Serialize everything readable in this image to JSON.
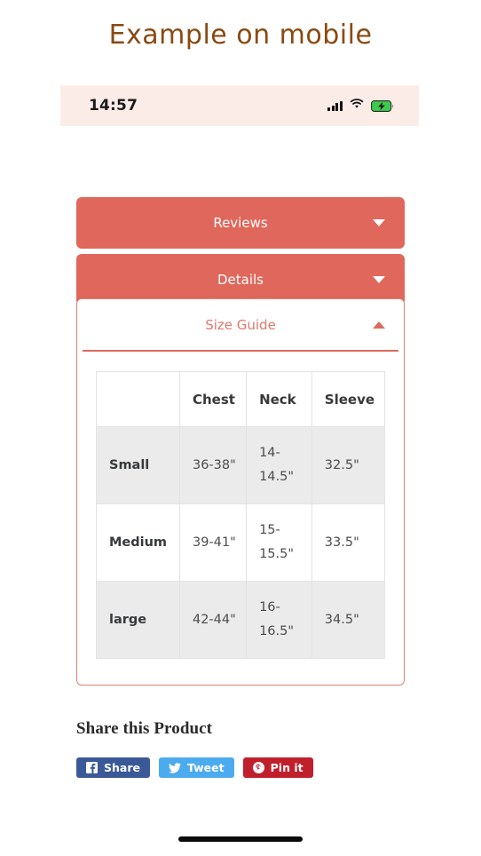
{
  "page": {
    "title": "Example on mobile",
    "title_color": "#8a4a12"
  },
  "status_bar": {
    "time": "14:57",
    "background": "#fcece8",
    "icons": [
      {
        "name": "signal-bars-icon",
        "label": "signal"
      },
      {
        "name": "wifi-icon",
        "label": "wifi"
      },
      {
        "name": "battery-charging-icon",
        "label": "battery charging",
        "color": "#3ecb4d"
      }
    ]
  },
  "accordion": {
    "accent_color": "#e0675b",
    "items": [
      {
        "label": "Reviews",
        "expanded": false,
        "icon": "chevron-down-icon"
      },
      {
        "label": "Details",
        "expanded": false,
        "icon": "chevron-down-icon"
      }
    ],
    "open_item": {
      "label": "Size Guide",
      "expanded": true,
      "icon": "chevron-up-icon",
      "label_color": "#e0786c"
    }
  },
  "size_table": {
    "headers": [
      "",
      "Chest",
      "Neck",
      "Sleeve"
    ],
    "rows": [
      {
        "size": "Small",
        "chest": "36-38\"",
        "neck": "14-14.5\"",
        "sleeve": "32.5\"",
        "shaded": true
      },
      {
        "size": "Medium",
        "chest": "39-41\"",
        "neck": "15-15.5\"",
        "sleeve": "33.5\"",
        "shaded": false
      },
      {
        "size": "large",
        "chest": "42-44\"",
        "neck": "16-16.5\"",
        "sleeve": "34.5\"",
        "shaded": true
      }
    ]
  },
  "share": {
    "heading": "Share this Product",
    "buttons": [
      {
        "label": "Share",
        "network": "facebook",
        "icon": "facebook-icon",
        "color": "#3b5998"
      },
      {
        "label": "Tweet",
        "network": "twitter",
        "icon": "twitter-icon",
        "color": "#4cabee"
      },
      {
        "label": "Pin it",
        "network": "pinterest",
        "icon": "pinterest-icon",
        "color": "#c0202c"
      }
    ]
  },
  "home_indicator": {
    "name": "home-indicator"
  }
}
